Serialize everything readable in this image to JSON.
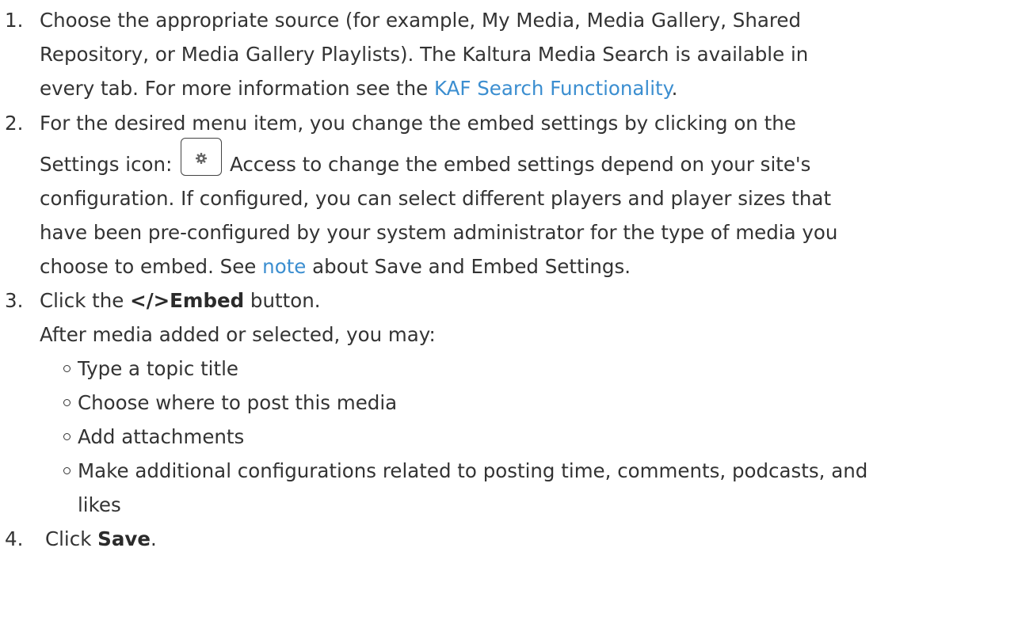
{
  "steps": {
    "s1": {
      "number": "1.",
      "line1": "Choose the appropriate source (for example, My Media, Media Gallery, Shared",
      "line2": "Repository, or Media Gallery Playlists). The Kaltura Media Search is available in",
      "line3_before": "every tab. For more information see the ",
      "line3_link": "KAF Search Functionality",
      "line3_after": "."
    },
    "s2": {
      "number": "2.",
      "line1": "For the desired menu item, you change the embed settings by clicking on the",
      "line2_before": "Settings icon:",
      "line2_after": "Access to change the embed settings depend on your site's",
      "line3": "configuration. If configured, you can select different players and player sizes that",
      "line4": "have been pre-configured by your system administrator for the type of media you",
      "line5_before": "choose to embed. See ",
      "line5_link": "note",
      "line5_after": " about Save and Embed Settings.",
      "icon": "gear-icon"
    },
    "s3": {
      "number": "3.",
      "before": "Click the ",
      "bold": "</>Embed",
      "after": " button.",
      "intro": "After media added or selected, you may:",
      "bullets": [
        "Type a topic title",
        "Choose where to post this media",
        "Add attachments",
        "Make additional configurations related to posting time, comments, podcasts, and"
      ],
      "bullet4_cont": "likes"
    },
    "s4": {
      "number": "4.",
      "before": "Click ",
      "bold": "Save",
      "after": "."
    }
  },
  "colors": {
    "text": "#333333",
    "link": "#3b8ed0"
  }
}
